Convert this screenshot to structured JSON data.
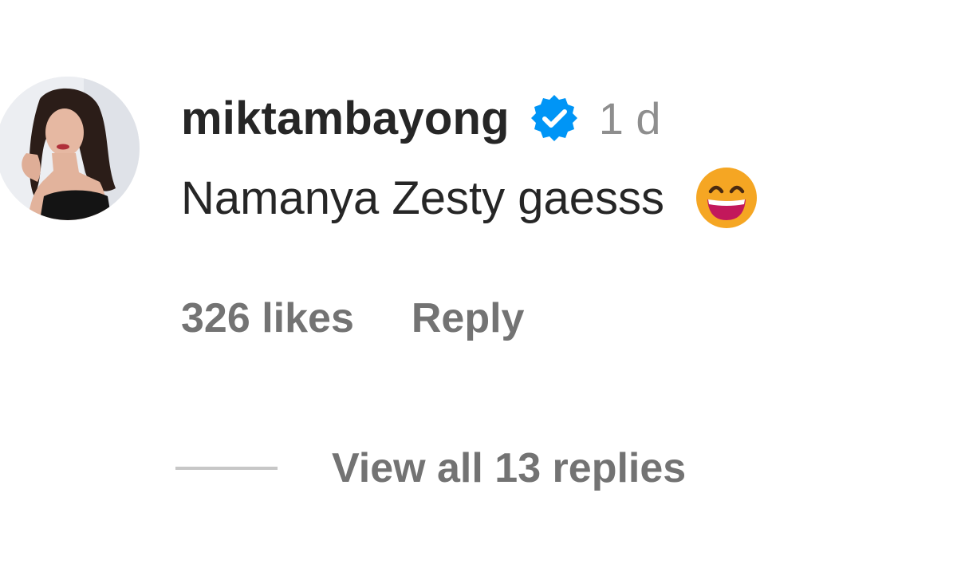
{
  "comment": {
    "username": "miktambayong",
    "timestamp": "1 d",
    "text": "Namanya Zesty gaesss",
    "likes_text": "326 likes",
    "reply_label": "Reply",
    "view_replies_label": "View all 13 replies"
  },
  "icons": {
    "verified": "verified-badge-icon",
    "emoji": "grinning-face-emoji"
  },
  "colors": {
    "verified_blue": "#0095f6",
    "primary_text": "#262626",
    "secondary_text": "#737373",
    "timestamp_text": "#8e8e8e",
    "emoji_face": "#f5a623",
    "emoji_mouth": "#c2185b"
  }
}
